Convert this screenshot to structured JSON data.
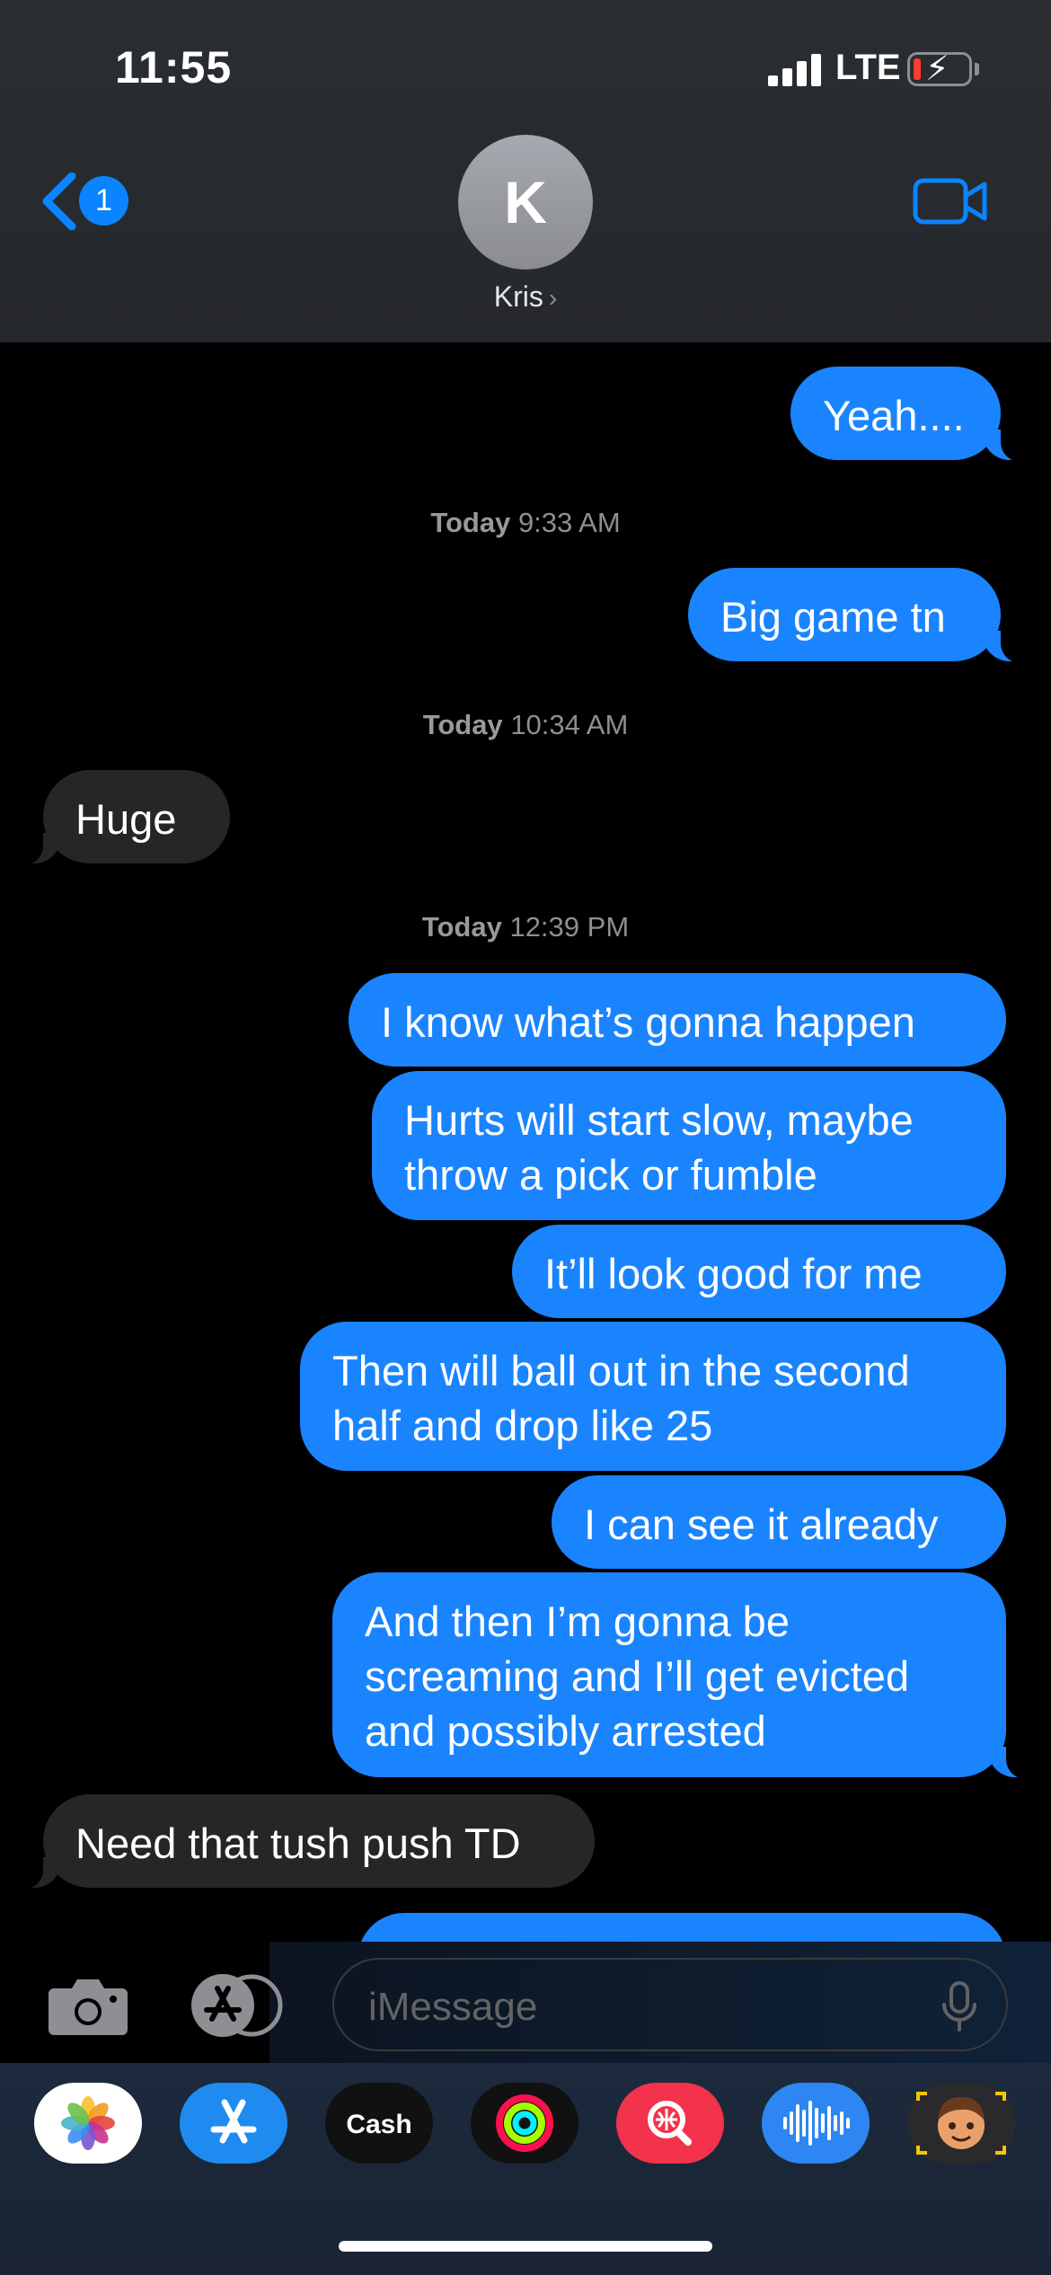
{
  "status": {
    "time": "11:55",
    "network": "LTE"
  },
  "header": {
    "back_badge": "1",
    "avatar_initial": "K",
    "contact_name": "Kris",
    "chevron": "›"
  },
  "messages": [
    {
      "kind": "out",
      "text": "Yeah...."
    },
    {
      "kind": "timestamp",
      "day": "Today",
      "time": "9:33 AM"
    },
    {
      "kind": "out",
      "text": "Big game tn"
    },
    {
      "kind": "timestamp",
      "day": "Today",
      "time": "10:34 AM"
    },
    {
      "kind": "in",
      "text": "Huge"
    },
    {
      "kind": "timestamp",
      "day": "Today",
      "time": "12:39 PM"
    },
    {
      "kind": "out",
      "text": "I know what’s gonna happen"
    },
    {
      "kind": "out",
      "text": "Hurts will start slow, maybe throw a pick or fumble"
    },
    {
      "kind": "out",
      "text": "It’ll look good for me"
    },
    {
      "kind": "out",
      "text": "Then will ball out in the second half and drop like 25"
    },
    {
      "kind": "out",
      "text": "I can see it already"
    },
    {
      "kind": "out",
      "text": "And then I’m gonna be screaming and I’ll get evicted and possibly arrested"
    },
    {
      "kind": "in",
      "text": "Need that tush push TD"
    }
  ],
  "composer": {
    "placeholder": "iMessage"
  },
  "app_drawer": [
    {
      "name": "photos-app-icon"
    },
    {
      "name": "app-store-icon"
    },
    {
      "name": "apple-cash-icon",
      "label": "Cash"
    },
    {
      "name": "fitness-activity-icon"
    },
    {
      "name": "image-search-icon"
    },
    {
      "name": "audio-message-icon"
    },
    {
      "name": "memoji-icon"
    }
  ],
  "colors": {
    "outgoing": "#1a84ff",
    "incoming": "#262628",
    "accent": "#0a84ff"
  }
}
